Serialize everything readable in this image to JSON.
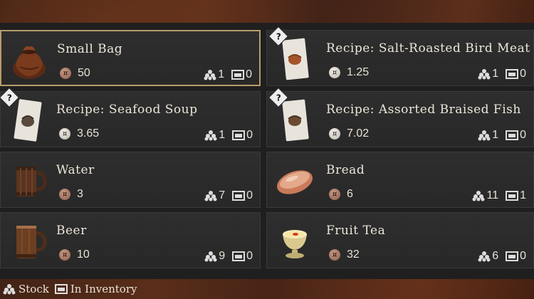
{
  "items": [
    {
      "name": "Small Bag",
      "price": "50",
      "coin": "copper",
      "stock": "1",
      "inventory": "0",
      "unknown": false,
      "selected": true,
      "icon": "bag-icon"
    },
    {
      "name": "Recipe: Salt-Roasted Bird Meat",
      "price": "1.25",
      "coin": "silver",
      "stock": "1",
      "inventory": "0",
      "unknown": true,
      "selected": false,
      "icon": "recipe-scroll-icon"
    },
    {
      "name": "Recipe: Seafood Soup",
      "price": "3.65",
      "coin": "silver",
      "stock": "1",
      "inventory": "0",
      "unknown": true,
      "selected": false,
      "icon": "recipe-scroll-icon"
    },
    {
      "name": "Recipe: Assorted Braised Fish",
      "price": "7.02",
      "coin": "silver",
      "stock": "1",
      "inventory": "0",
      "unknown": true,
      "selected": false,
      "icon": "recipe-scroll-icon"
    },
    {
      "name": "Water",
      "price": "3",
      "coin": "copper",
      "stock": "7",
      "inventory": "0",
      "unknown": false,
      "selected": false,
      "icon": "mug-icon"
    },
    {
      "name": "Bread",
      "price": "6",
      "coin": "copper",
      "stock": "11",
      "inventory": "1",
      "unknown": false,
      "selected": false,
      "icon": "bread-icon"
    },
    {
      "name": "Beer",
      "price": "10",
      "coin": "copper",
      "stock": "9",
      "inventory": "0",
      "unknown": false,
      "selected": false,
      "icon": "tankard-icon"
    },
    {
      "name": "Fruit Tea",
      "price": "32",
      "coin": "copper",
      "stock": "6",
      "inventory": "0",
      "unknown": false,
      "selected": false,
      "icon": "tea-cup-icon"
    }
  ],
  "legend": {
    "stock_label": "Stock",
    "inventory_label": "In Inventory"
  },
  "unknown_mark": "?",
  "colors": {
    "selected_border": "#b89b6a",
    "card_bg": "#2e2e2e",
    "copper_coin": "#a97a66",
    "silver_coin": "#e6e2dc"
  }
}
